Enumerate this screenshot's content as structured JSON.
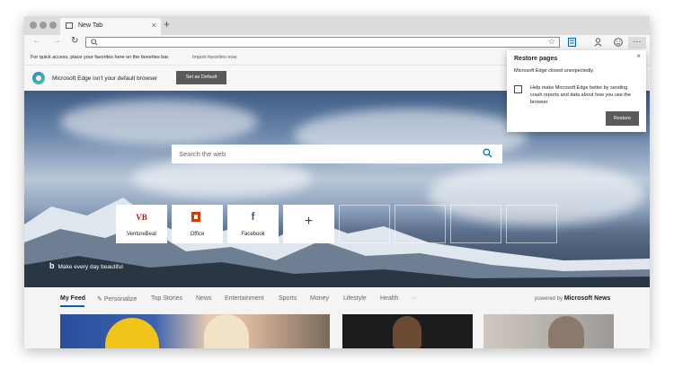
{
  "tab": {
    "title": "New Tab",
    "close": "×",
    "new_tab": "+"
  },
  "toolbar": {
    "back": "←",
    "forward": "→",
    "refresh": "↻",
    "favorite": "☆",
    "more": "···"
  },
  "favorites_bar": {
    "hint": "For quick access, place your favorites here on the favorites bar.",
    "import_link": "Import favorites now"
  },
  "default_bar": {
    "message": "Microsoft Edge isn't your default browser",
    "button": "Set as Default"
  },
  "search": {
    "placeholder": "Search the web"
  },
  "tiles": [
    {
      "label": "VentureBeat",
      "logo": "VB"
    },
    {
      "label": "Office"
    },
    {
      "label": "Facebook",
      "logo": "f"
    },
    {
      "label": "+"
    }
  ],
  "bing": {
    "logo": "b",
    "text": "Make every day beautiful"
  },
  "feed_nav": {
    "items": [
      "My Feed",
      "Personalize",
      "Top Stories",
      "News",
      "Entertainment",
      "Sports",
      "Money",
      "Lifestyle",
      "Health",
      "···"
    ],
    "powered_by": "powered by",
    "powered_brand": "Microsoft News"
  },
  "restore_popup": {
    "title": "Restore pages",
    "message": "Microsoft Edge closed unexpectedly.",
    "checkbox": "Help make Microsoft Edge better by sending crash reports and data about how you use the browser",
    "button": "Restore",
    "close": "×"
  },
  "colors": {
    "accent": "#0063b1",
    "button_dark": "#5a5a5a",
    "chrome": "#f7f7f7"
  }
}
